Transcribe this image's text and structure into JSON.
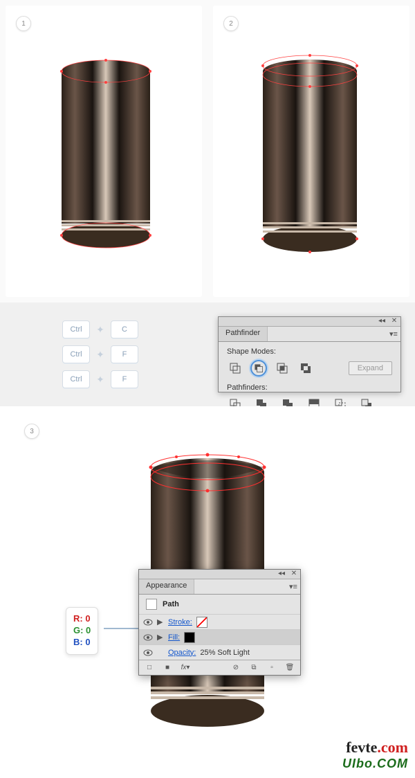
{
  "steps": {
    "one": "1",
    "two": "2",
    "three": "3"
  },
  "shortcuts": [
    {
      "mod": "Ctrl",
      "key": "C"
    },
    {
      "mod": "Ctrl",
      "key": "F"
    },
    {
      "mod": "Ctrl",
      "key": "F"
    }
  ],
  "pathfinder": {
    "tab": "Pathfinder",
    "shape_modes_label": "Shape Modes:",
    "pathfinders_label": "Pathfinders:",
    "expand_label": "Expand",
    "shape_icons": [
      "unite-icon",
      "minus-front-icon",
      "intersect-icon",
      "exclude-icon"
    ],
    "pf_icons": [
      "divide-icon",
      "trim-icon",
      "merge-icon",
      "crop-icon",
      "outline-icon",
      "minus-back-icon"
    ]
  },
  "appearance": {
    "tab": "Appearance",
    "title": "Path",
    "rows": [
      {
        "label": "Stroke:",
        "swatch": "none"
      },
      {
        "label": "Fill:",
        "swatch": "black"
      },
      {
        "label": "Opacity:",
        "value": "25% Soft Light"
      }
    ],
    "footer_icons": [
      "add-stroke",
      "add-fill",
      "fx",
      "clear",
      "dup",
      "new",
      "trash"
    ]
  },
  "rgb": {
    "r": "R: 0",
    "g": "G: 0",
    "b": "B: 0"
  },
  "watermark": {
    "top": "fevte",
    "top_suffix": ".com",
    "bottom": "UIbo.COM"
  }
}
